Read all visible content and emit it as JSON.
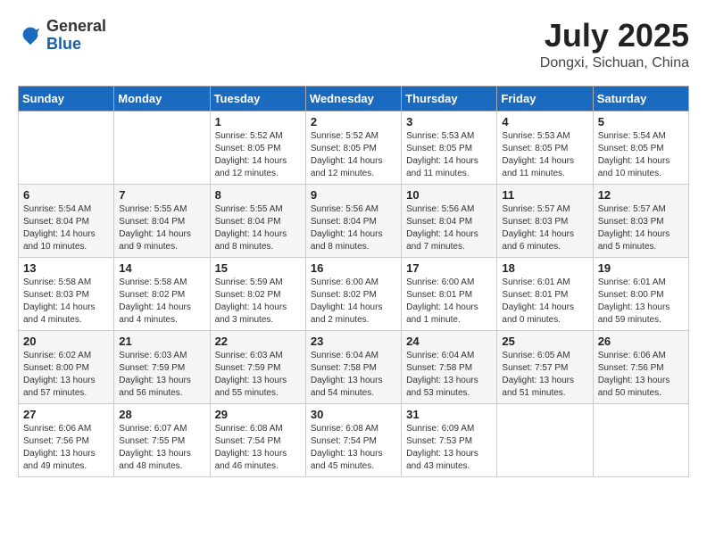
{
  "header": {
    "logo": {
      "general": "General",
      "blue": "Blue"
    },
    "title": "July 2025",
    "location": "Dongxi, Sichuan, China"
  },
  "weekdays": [
    "Sunday",
    "Monday",
    "Tuesday",
    "Wednesday",
    "Thursday",
    "Friday",
    "Saturday"
  ],
  "weeks": [
    [
      {
        "day": "",
        "info": ""
      },
      {
        "day": "",
        "info": ""
      },
      {
        "day": "1",
        "info": "Sunrise: 5:52 AM\nSunset: 8:05 PM\nDaylight: 14 hours and 12 minutes."
      },
      {
        "day": "2",
        "info": "Sunrise: 5:52 AM\nSunset: 8:05 PM\nDaylight: 14 hours and 12 minutes."
      },
      {
        "day": "3",
        "info": "Sunrise: 5:53 AM\nSunset: 8:05 PM\nDaylight: 14 hours and 11 minutes."
      },
      {
        "day": "4",
        "info": "Sunrise: 5:53 AM\nSunset: 8:05 PM\nDaylight: 14 hours and 11 minutes."
      },
      {
        "day": "5",
        "info": "Sunrise: 5:54 AM\nSunset: 8:05 PM\nDaylight: 14 hours and 10 minutes."
      }
    ],
    [
      {
        "day": "6",
        "info": "Sunrise: 5:54 AM\nSunset: 8:04 PM\nDaylight: 14 hours and 10 minutes."
      },
      {
        "day": "7",
        "info": "Sunrise: 5:55 AM\nSunset: 8:04 PM\nDaylight: 14 hours and 9 minutes."
      },
      {
        "day": "8",
        "info": "Sunrise: 5:55 AM\nSunset: 8:04 PM\nDaylight: 14 hours and 8 minutes."
      },
      {
        "day": "9",
        "info": "Sunrise: 5:56 AM\nSunset: 8:04 PM\nDaylight: 14 hours and 8 minutes."
      },
      {
        "day": "10",
        "info": "Sunrise: 5:56 AM\nSunset: 8:04 PM\nDaylight: 14 hours and 7 minutes."
      },
      {
        "day": "11",
        "info": "Sunrise: 5:57 AM\nSunset: 8:03 PM\nDaylight: 14 hours and 6 minutes."
      },
      {
        "day": "12",
        "info": "Sunrise: 5:57 AM\nSunset: 8:03 PM\nDaylight: 14 hours and 5 minutes."
      }
    ],
    [
      {
        "day": "13",
        "info": "Sunrise: 5:58 AM\nSunset: 8:03 PM\nDaylight: 14 hours and 4 minutes."
      },
      {
        "day": "14",
        "info": "Sunrise: 5:58 AM\nSunset: 8:02 PM\nDaylight: 14 hours and 4 minutes."
      },
      {
        "day": "15",
        "info": "Sunrise: 5:59 AM\nSunset: 8:02 PM\nDaylight: 14 hours and 3 minutes."
      },
      {
        "day": "16",
        "info": "Sunrise: 6:00 AM\nSunset: 8:02 PM\nDaylight: 14 hours and 2 minutes."
      },
      {
        "day": "17",
        "info": "Sunrise: 6:00 AM\nSunset: 8:01 PM\nDaylight: 14 hours and 1 minute."
      },
      {
        "day": "18",
        "info": "Sunrise: 6:01 AM\nSunset: 8:01 PM\nDaylight: 14 hours and 0 minutes."
      },
      {
        "day": "19",
        "info": "Sunrise: 6:01 AM\nSunset: 8:00 PM\nDaylight: 13 hours and 59 minutes."
      }
    ],
    [
      {
        "day": "20",
        "info": "Sunrise: 6:02 AM\nSunset: 8:00 PM\nDaylight: 13 hours and 57 minutes."
      },
      {
        "day": "21",
        "info": "Sunrise: 6:03 AM\nSunset: 7:59 PM\nDaylight: 13 hours and 56 minutes."
      },
      {
        "day": "22",
        "info": "Sunrise: 6:03 AM\nSunset: 7:59 PM\nDaylight: 13 hours and 55 minutes."
      },
      {
        "day": "23",
        "info": "Sunrise: 6:04 AM\nSunset: 7:58 PM\nDaylight: 13 hours and 54 minutes."
      },
      {
        "day": "24",
        "info": "Sunrise: 6:04 AM\nSunset: 7:58 PM\nDaylight: 13 hours and 53 minutes."
      },
      {
        "day": "25",
        "info": "Sunrise: 6:05 AM\nSunset: 7:57 PM\nDaylight: 13 hours and 51 minutes."
      },
      {
        "day": "26",
        "info": "Sunrise: 6:06 AM\nSunset: 7:56 PM\nDaylight: 13 hours and 50 minutes."
      }
    ],
    [
      {
        "day": "27",
        "info": "Sunrise: 6:06 AM\nSunset: 7:56 PM\nDaylight: 13 hours and 49 minutes."
      },
      {
        "day": "28",
        "info": "Sunrise: 6:07 AM\nSunset: 7:55 PM\nDaylight: 13 hours and 48 minutes."
      },
      {
        "day": "29",
        "info": "Sunrise: 6:08 AM\nSunset: 7:54 PM\nDaylight: 13 hours and 46 minutes."
      },
      {
        "day": "30",
        "info": "Sunrise: 6:08 AM\nSunset: 7:54 PM\nDaylight: 13 hours and 45 minutes."
      },
      {
        "day": "31",
        "info": "Sunrise: 6:09 AM\nSunset: 7:53 PM\nDaylight: 13 hours and 43 minutes."
      },
      {
        "day": "",
        "info": ""
      },
      {
        "day": "",
        "info": ""
      }
    ]
  ]
}
